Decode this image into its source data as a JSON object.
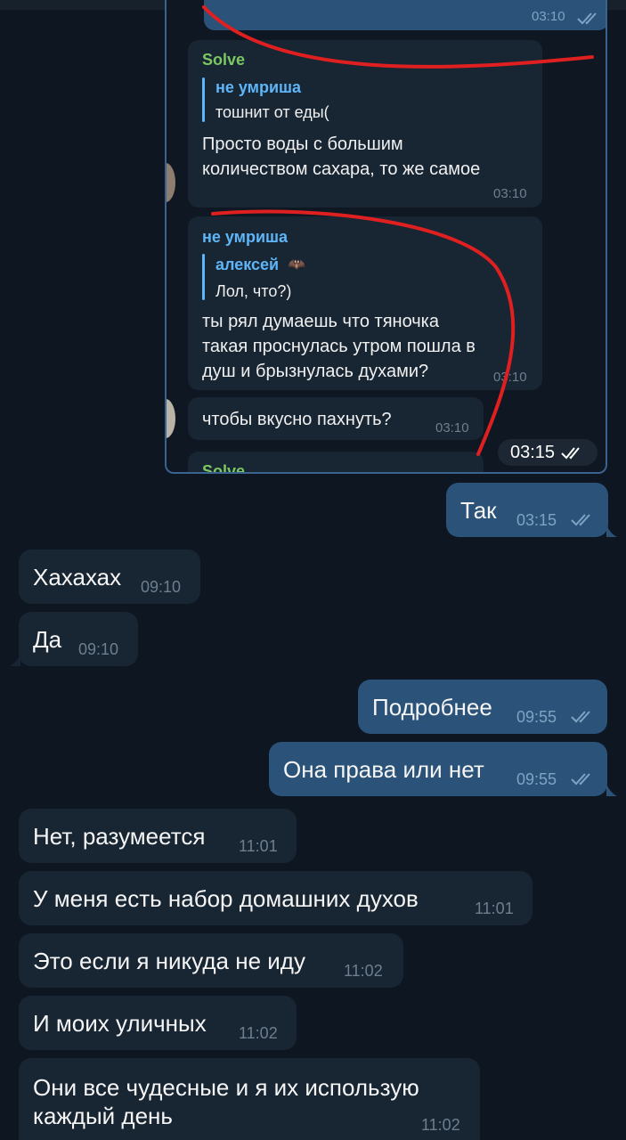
{
  "screenshot": {
    "top_time": "03:10",
    "msg1": {
      "sender": "Solve",
      "reply_author": "не умриша",
      "reply_text": "тошнит от еды(",
      "text_lines": [
        "Просто воды с большим",
        "количеством сахара, то же самое"
      ],
      "time": "03:10"
    },
    "msg2": {
      "sender": "не умриша",
      "reply_author": "алексей",
      "reply_text": "Лол, что?)",
      "text_lines": [
        "ты рял думаешь что тяночка",
        "такая проснулась утром пошла в",
        "душ и брызнулась духами?"
      ],
      "time": "03:10"
    },
    "msg3": {
      "text": "чтобы вкусно пахнуть?",
      "time": "03:10"
    },
    "msg4_sender": "Solve",
    "image_time": "03:15",
    "ink_color": "#e02020"
  },
  "messages": [
    {
      "dir": "out",
      "text": "Так",
      "time": "03:15"
    },
    {
      "dir": "in",
      "text": "Хахахах",
      "time": "09:10"
    },
    {
      "dir": "in",
      "text": "Да",
      "time": "09:10"
    },
    {
      "dir": "out",
      "text": "Подробнее",
      "time": "09:55"
    },
    {
      "dir": "out",
      "text": "Она права или нет",
      "time": "09:55"
    },
    {
      "dir": "in",
      "text": "Нет, разумеется",
      "time": "11:01"
    },
    {
      "dir": "in",
      "text": "У меня есть набор домашних духов",
      "time": "11:01"
    },
    {
      "dir": "in",
      "text": "Это если я никуда не иду",
      "time": "11:02"
    },
    {
      "dir": "in",
      "text": "И моих уличных",
      "time": "11:02"
    },
    {
      "dir": "in",
      "text_lines": [
        "Они все чудесные и я их использую",
        "каждый день"
      ],
      "time": "11:02"
    }
  ],
  "colors": {
    "background": "#0e1621",
    "incoming_bubble": "#182533",
    "outgoing_bubble": "#2b5278",
    "accent": "#5eb5f7",
    "sender_green": "#7bc862",
    "read_check": "#7ea3c4"
  }
}
